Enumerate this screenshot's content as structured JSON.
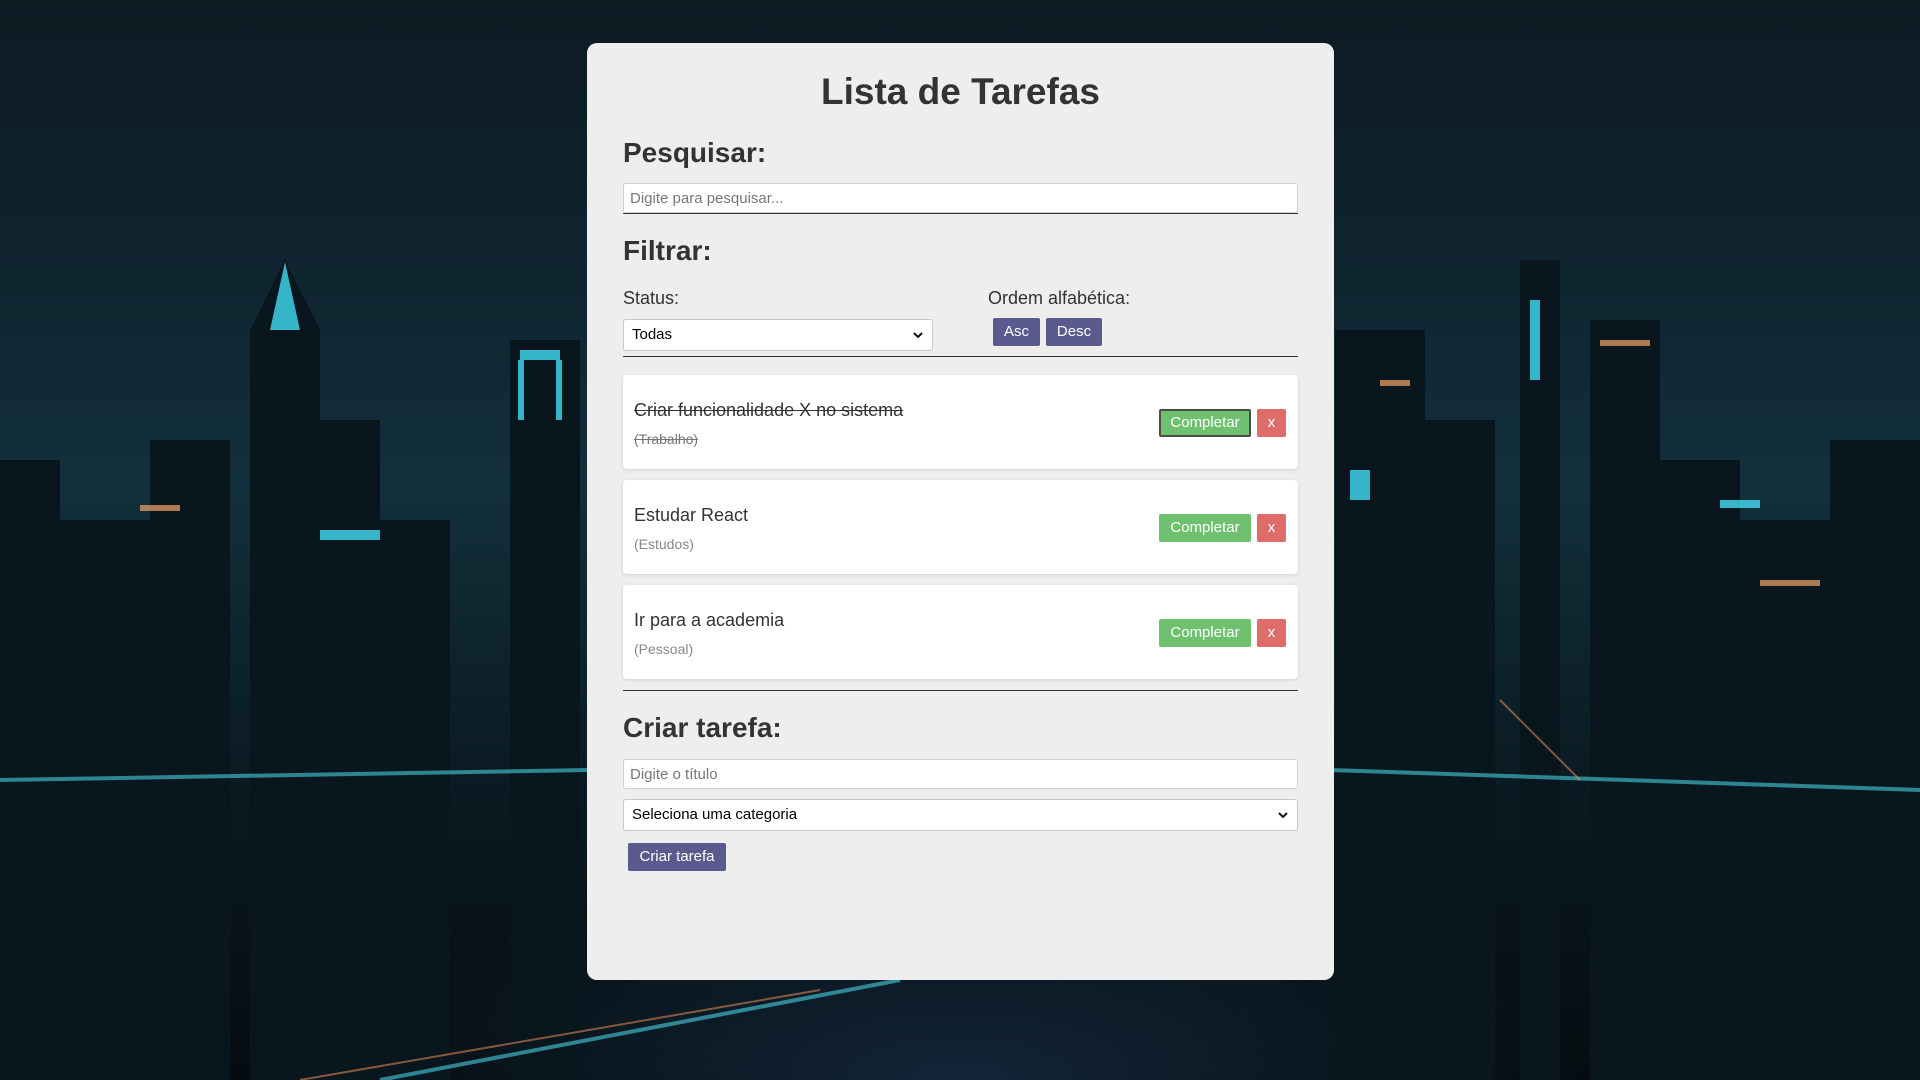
{
  "app": {
    "title": "Lista de Tarefas"
  },
  "search": {
    "heading": "Pesquisar:",
    "placeholder": "Digite para pesquisar...",
    "value": ""
  },
  "filter": {
    "heading": "Filtrar:",
    "status_label": "Status:",
    "status_selected": "Todas",
    "order_label": "Ordem alfabética:",
    "asc_label": "Asc",
    "desc_label": "Desc"
  },
  "tasks": [
    {
      "title": "Criar funcionalidade X no sistema",
      "category": "(Trabalho)",
      "completed": true,
      "complete_label": "Completar",
      "delete_label": "x"
    },
    {
      "title": "Estudar React",
      "category": "(Estudos)",
      "completed": false,
      "complete_label": "Completar",
      "delete_label": "x"
    },
    {
      "title": "Ir para a academia",
      "category": "(Pessoal)",
      "completed": false,
      "complete_label": "Completar",
      "delete_label": "x"
    }
  ],
  "create": {
    "heading": "Criar tarefa:",
    "title_placeholder": "Digite o título",
    "category_selected": "Seleciona uma categoria",
    "button_label": "Criar tarefa"
  },
  "colors": {
    "panel_bg": "#eeeeee",
    "button_purple": "#5a5a8e",
    "button_green": "#5cb85c",
    "button_red": "#d9534f"
  },
  "icons": {
    "select_arrow": "chevron-down-icon"
  }
}
